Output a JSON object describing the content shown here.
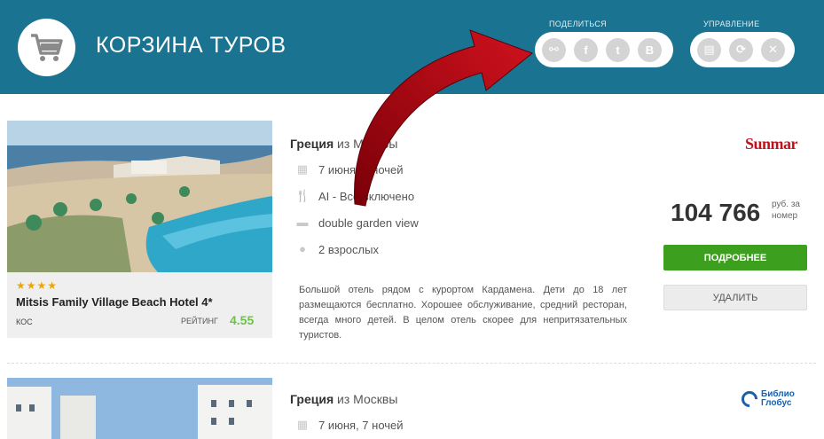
{
  "header": {
    "title": "КОРЗИНА ТУРОВ",
    "share_label": "ПОДЕЛИТЬСЯ",
    "manage_label": "УПРАВЛЕНИЕ",
    "share_icons": [
      "link-icon",
      "facebook-icon",
      "twitter-icon",
      "vkontakte-icon"
    ],
    "share_glyphs": [
      "⚯",
      "f",
      "t",
      "B"
    ],
    "manage_icons": [
      "print-icon",
      "refresh-icon",
      "close-icon"
    ],
    "manage_glyphs": [
      "▤",
      "⟳",
      "✕"
    ],
    "background_color": "#1a7391"
  },
  "tours": [
    {
      "country": "Греция",
      "from": "из Москвы",
      "dates": "7 июня, 7 ночей",
      "meal": "AI - Все включено",
      "room": "double garden view",
      "guests": "2 взрослых",
      "stars": "★★★★",
      "hotel": "Mitsis Family Village Beach Hotel 4*",
      "region": "КОС",
      "rating_label": "РЕЙТИНГ",
      "rating": "4.55",
      "description": "Большой отель рядом с курортом Кардамена. Дети до 18 лет размещаются бесплатно. Хорошее обслуживание, средний ресторан, всегда много детей. В целом отель скорее для непритязательных туристов.",
      "price": "104 766",
      "price_unit": "руб. за номер",
      "more_button": "ПОДРОБНЕЕ",
      "delete_button": "УДАЛИТЬ",
      "operator": "Sunmar"
    },
    {
      "country": "Греция",
      "from": "из Москвы",
      "dates": "7 июня, 7 ночей",
      "operator_line1": "Библио",
      "operator_line2": "Глобус"
    }
  ],
  "colors": {
    "accent_green": "#3c9f1e",
    "rating_green": "#6cc24a",
    "star_color": "#f0a500",
    "arrow_red": "#c0121d"
  }
}
